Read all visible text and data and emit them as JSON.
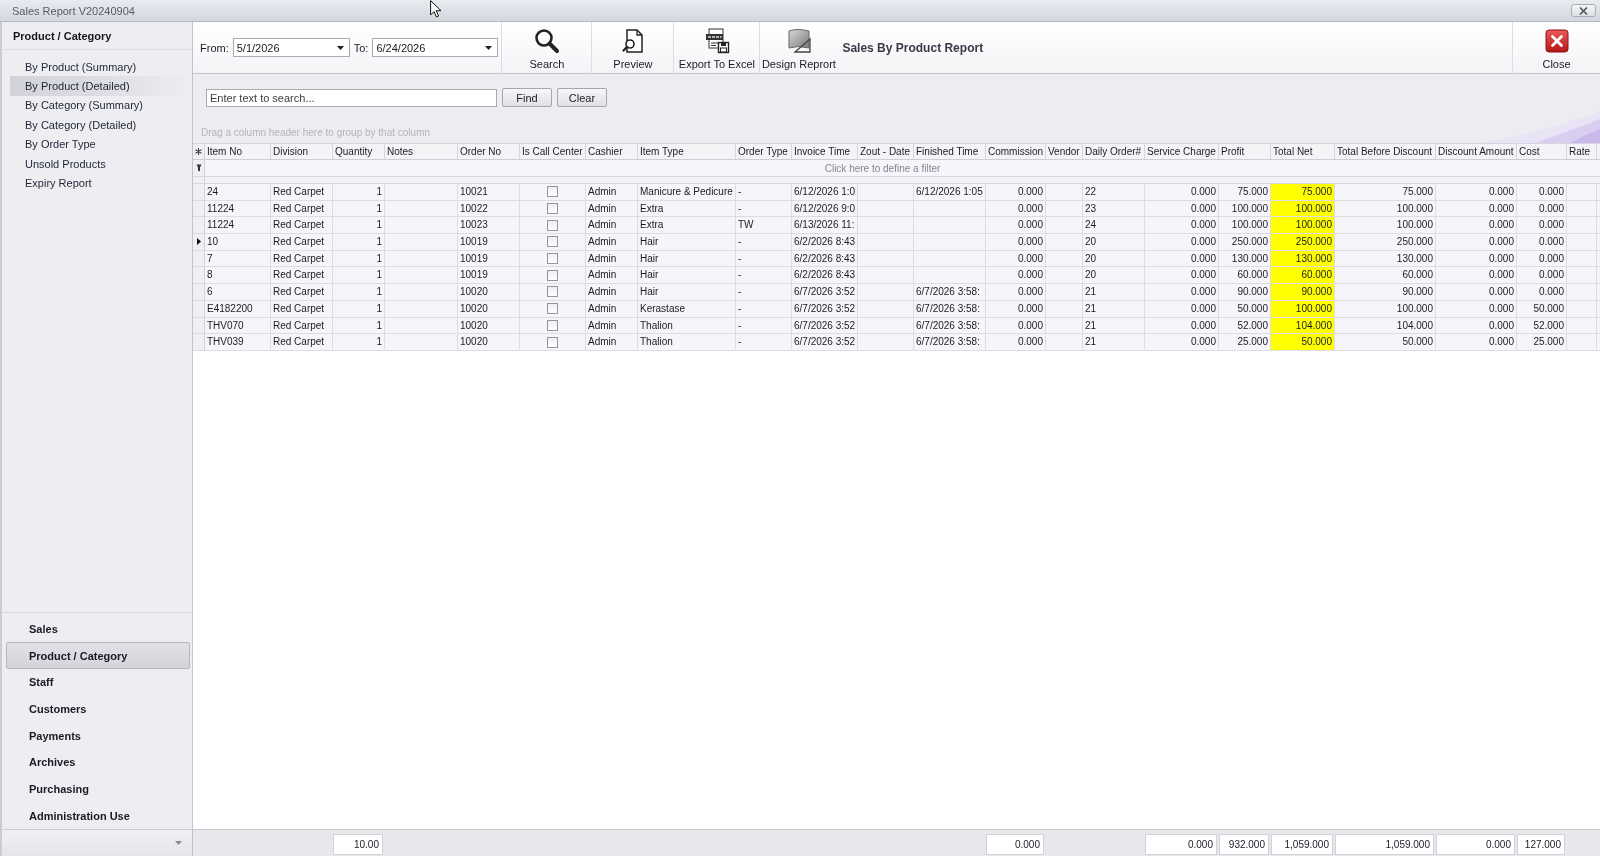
{
  "window": {
    "title": "Sales Report V20240904"
  },
  "sidebar": {
    "header": "Product / Category",
    "reports": [
      {
        "label": "By Product (Summary)",
        "selected": false
      },
      {
        "label": "By Product (Detailed)",
        "selected": true
      },
      {
        "label": "By Category (Summary)",
        "selected": false
      },
      {
        "label": "By Category (Detailed)",
        "selected": false
      },
      {
        "label": "By Order Type",
        "selected": false
      },
      {
        "label": "Unsold Products",
        "selected": false
      },
      {
        "label": "Expiry Report",
        "selected": false
      }
    ],
    "nav": [
      {
        "label": "Sales",
        "selected": false
      },
      {
        "label": "Product / Category",
        "selected": true
      },
      {
        "label": "Staff",
        "selected": false
      },
      {
        "label": "Customers",
        "selected": false
      },
      {
        "label": "Payments",
        "selected": false
      },
      {
        "label": "Archives",
        "selected": false
      },
      {
        "label": "Purchasing",
        "selected": false
      },
      {
        "label": "Administration Use",
        "selected": false
      }
    ]
  },
  "toolbar": {
    "from": {
      "label": "From:",
      "value": "5/1/2026"
    },
    "to": {
      "label": "To:",
      "value": "6/24/2026"
    },
    "buttons": [
      {
        "label": "Search",
        "kind": "search"
      },
      {
        "label": "Preview",
        "kind": "preview"
      },
      {
        "label": "Export To Excel",
        "kind": "excel"
      },
      {
        "label": "Design Reprort",
        "kind": "design"
      }
    ],
    "report_title": "Sales By Product Report",
    "close": {
      "label": "Close"
    }
  },
  "search": {
    "placeholder": "Enter text to search...",
    "buttons": [
      "Find",
      "Clear"
    ]
  },
  "grid": {
    "group_hint": "Drag a column header here to group by that column",
    "filter_hint": "Click here to define a filter",
    "columns": [
      {
        "label": "Item No",
        "kind": "text",
        "highlighted": false
      },
      {
        "label": "Division",
        "kind": "text",
        "highlighted": false
      },
      {
        "label": "Quantity",
        "kind": "number",
        "highlighted": false
      },
      {
        "label": "Notes",
        "kind": "text",
        "highlighted": false
      },
      {
        "label": "Order No",
        "kind": "text",
        "highlighted": false
      },
      {
        "label": "Is Call Center",
        "kind": "check",
        "highlighted": false
      },
      {
        "label": "Cashier",
        "kind": "text",
        "highlighted": false
      },
      {
        "label": "Item Type",
        "kind": "text",
        "highlighted": false
      },
      {
        "label": "Order Type",
        "kind": "text",
        "highlighted": false
      },
      {
        "label": "Invoice Time",
        "kind": "text",
        "highlighted": false
      },
      {
        "label": "Zout - Date",
        "kind": "text",
        "highlighted": false
      },
      {
        "label": "Finished Time",
        "kind": "text",
        "highlighted": false
      },
      {
        "label": "Commission",
        "kind": "number",
        "highlighted": false
      },
      {
        "label": "Vendor",
        "kind": "text",
        "highlighted": false
      },
      {
        "label": "Daily Order#",
        "kind": "text",
        "highlighted": false
      },
      {
        "label": "Service Charge",
        "kind": "number",
        "highlighted": false
      },
      {
        "label": "Profit",
        "kind": "number",
        "highlighted": false
      },
      {
        "label": "Total Net",
        "kind": "number",
        "highlighted": true
      },
      {
        "label": "Total Before Discount",
        "kind": "number",
        "highlighted": false
      },
      {
        "label": "Discount Amount",
        "kind": "number",
        "highlighted": false
      },
      {
        "label": "Cost",
        "kind": "number",
        "highlighted": false
      },
      {
        "label": "Rate",
        "kind": "number",
        "highlighted": false
      }
    ],
    "rows": [
      {
        "selected": false,
        "item_no": "24",
        "division": "Red Carpet",
        "quantity": "1",
        "order_no": "10021",
        "is_call_center": false,
        "cashier": "Admin",
        "item_type": "Manicure & Pedicure",
        "order_type": "-",
        "invoice_time": "6/12/2026 1:0",
        "finished_time": "6/12/2026 1:05",
        "commission": "0.000",
        "daily_order": "22",
        "service_charge": "0.000",
        "profit": "75.000",
        "total_net": "75.000",
        "total_before_discount": "75.000",
        "discount_amount": "0.000",
        "cost": "0.000"
      },
      {
        "selected": false,
        "item_no": "11224",
        "division": "Red Carpet",
        "quantity": "1",
        "order_no": "10022",
        "is_call_center": false,
        "cashier": "Admin",
        "item_type": "Extra",
        "order_type": "-",
        "invoice_time": "6/12/2026 9:0",
        "commission": "0.000",
        "daily_order": "23",
        "service_charge": "0.000",
        "profit": "100.000",
        "total_net": "100.000",
        "total_before_discount": "100.000",
        "discount_amount": "0.000",
        "cost": "0.000"
      },
      {
        "selected": false,
        "item_no": "11224",
        "division": "Red Carpet",
        "quantity": "1",
        "order_no": "10023",
        "is_call_center": false,
        "cashier": "Admin",
        "item_type": "Extra",
        "order_type": "TW",
        "invoice_time": "6/13/2026 11:",
        "commission": "0.000",
        "daily_order": "24",
        "service_charge": "0.000",
        "profit": "100.000",
        "total_net": "100.000",
        "total_before_discount": "100.000",
        "discount_amount": "0.000",
        "cost": "0.000"
      },
      {
        "selected": true,
        "item_no": "10",
        "division": "Red Carpet",
        "quantity": "1",
        "order_no": "10019",
        "is_call_center": false,
        "cashier": "Admin",
        "item_type": "Hair",
        "order_type": "-",
        "invoice_time": "6/2/2026 8:43",
        "commission": "0.000",
        "daily_order": "20",
        "service_charge": "0.000",
        "profit": "250.000",
        "total_net": "250.000",
        "total_before_discount": "250.000",
        "discount_amount": "0.000",
        "cost": "0.000"
      },
      {
        "selected": false,
        "item_no": "7",
        "division": "Red Carpet",
        "quantity": "1",
        "order_no": "10019",
        "is_call_center": false,
        "cashier": "Admin",
        "item_type": "Hair",
        "order_type": "-",
        "invoice_time": "6/2/2026 8:43",
        "commission": "0.000",
        "daily_order": "20",
        "service_charge": "0.000",
        "profit": "130.000",
        "total_net": "130.000",
        "total_before_discount": "130.000",
        "discount_amount": "0.000",
        "cost": "0.000"
      },
      {
        "selected": false,
        "item_no": "8",
        "division": "Red Carpet",
        "quantity": "1",
        "order_no": "10019",
        "is_call_center": false,
        "cashier": "Admin",
        "item_type": "Hair",
        "order_type": "-",
        "invoice_time": "6/2/2026 8:43",
        "commission": "0.000",
        "daily_order": "20",
        "service_charge": "0.000",
        "profit": "60.000",
        "total_net": "60.000",
        "total_before_discount": "60.000",
        "discount_amount": "0.000",
        "cost": "0.000"
      },
      {
        "selected": false,
        "item_no": "6",
        "division": "Red Carpet",
        "quantity": "1",
        "order_no": "10020",
        "is_call_center": false,
        "cashier": "Admin",
        "item_type": "Hair",
        "order_type": "-",
        "invoice_time": "6/7/2026 3:52",
        "finished_time": "6/7/2026 3:58:",
        "commission": "0.000",
        "daily_order": "21",
        "service_charge": "0.000",
        "profit": "90.000",
        "total_net": "90.000",
        "total_before_discount": "90.000",
        "discount_amount": "0.000",
        "cost": "0.000"
      },
      {
        "selected": false,
        "item_no": "E4182200",
        "division": "Red Carpet",
        "quantity": "1",
        "order_no": "10020",
        "is_call_center": false,
        "cashier": "Admin",
        "item_type": "Kerastase",
        "order_type": "-",
        "invoice_time": "6/7/2026 3:52",
        "finished_time": "6/7/2026 3:58:",
        "commission": "0.000",
        "daily_order": "21",
        "service_charge": "0.000",
        "profit": "50.000",
        "total_net": "100.000",
        "total_before_discount": "100.000",
        "discount_amount": "0.000",
        "cost": "50.000"
      },
      {
        "selected": false,
        "item_no": "THV070",
        "division": "Red Carpet",
        "quantity": "1",
        "order_no": "10020",
        "is_call_center": false,
        "cashier": "Admin",
        "item_type": "Thalion",
        "order_type": "-",
        "invoice_time": "6/7/2026 3:52",
        "finished_time": "6/7/2026 3:58:",
        "commission": "0.000",
        "daily_order": "21",
        "service_charge": "0.000",
        "profit": "52.000",
        "total_net": "104.000",
        "total_before_discount": "104.000",
        "discount_amount": "0.000",
        "cost": "52.000"
      },
      {
        "selected": false,
        "item_no": "THV039",
        "division": "Red Carpet",
        "quantity": "1",
        "order_no": "10020",
        "is_call_center": false,
        "cashier": "Admin",
        "item_type": "Thalion",
        "order_type": "-",
        "invoice_time": "6/7/2026 3:52",
        "finished_time": "6/7/2026 3:58:",
        "commission": "0.000",
        "daily_order": "21",
        "service_charge": "0.000",
        "profit": "25.000",
        "total_net": "50.000",
        "total_before_discount": "50.000",
        "discount_amount": "0.000",
        "cost": "25.000"
      }
    ],
    "totals": {
      "quantity": "10.00",
      "commission": "0.000",
      "service_charge": "0.000",
      "profit": "932.000",
      "total_net": "1,059.000",
      "total_before_discount": "1,059.000",
      "discount_amount": "0.000",
      "cost": "127.000"
    }
  }
}
